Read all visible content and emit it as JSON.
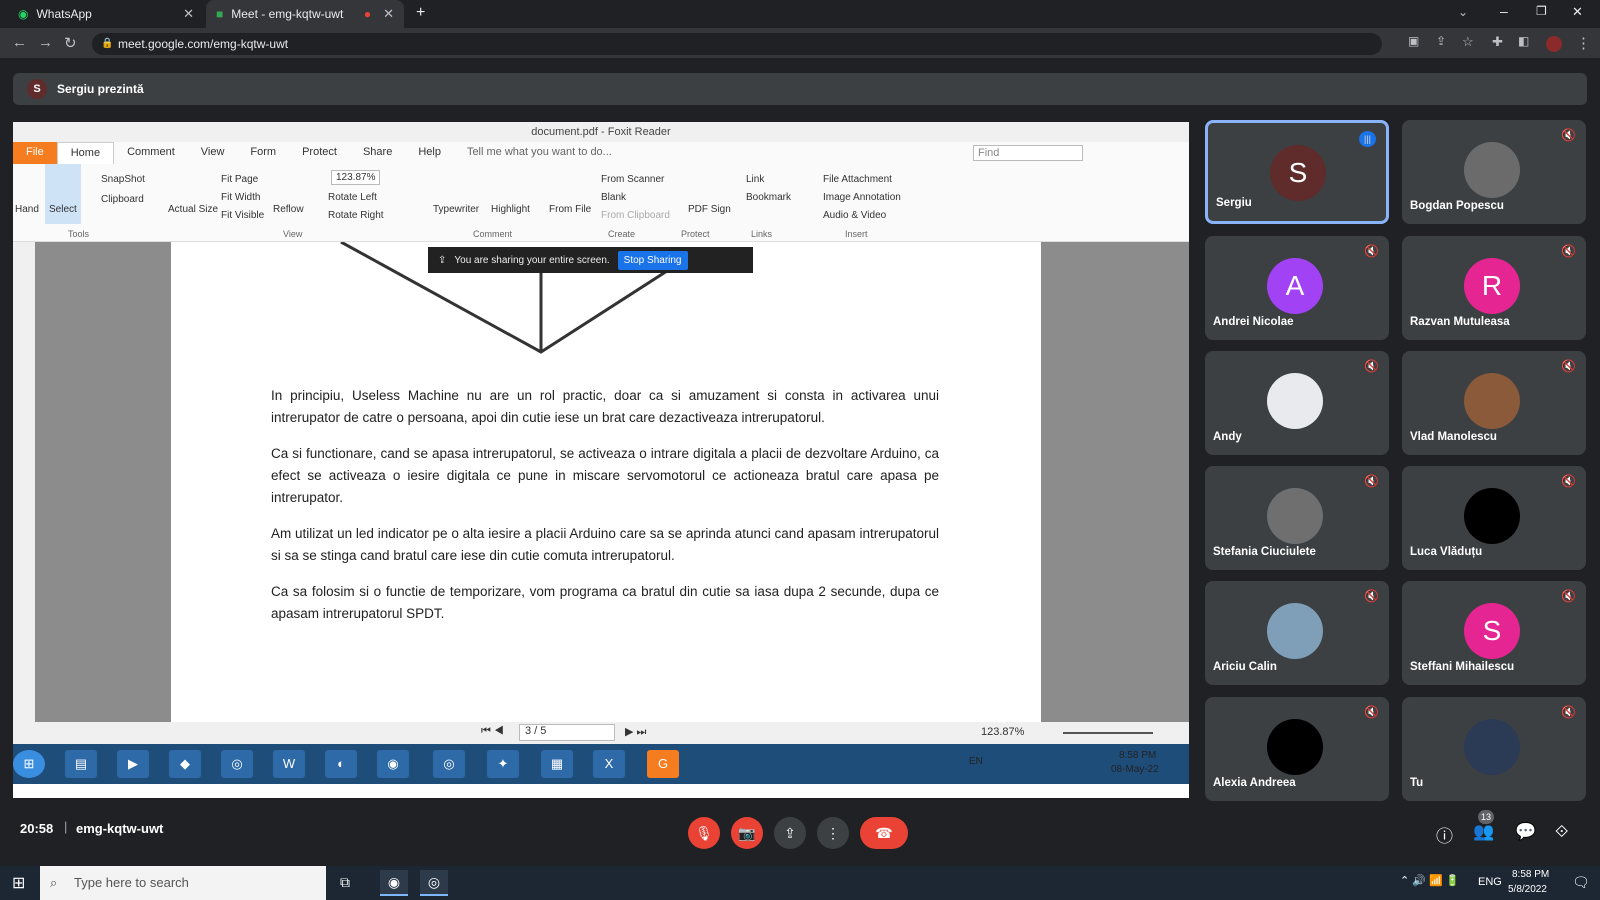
{
  "browser": {
    "tabs": [
      {
        "title": "WhatsApp",
        "icon": "whatsapp-icon"
      },
      {
        "title": "Meet - emg-kqtw-uwt",
        "icon": "meet-icon"
      }
    ],
    "url": "meet.google.com/emg-kqtw-uwt"
  },
  "meet": {
    "presenter_text": "Sergiu prezintă",
    "presenter_initial": "S",
    "time": "20:58",
    "meeting_code": "emg-kqtw-uwt",
    "participants_count": "13",
    "participants": [
      {
        "name": "Sergiu",
        "initial": "S",
        "color": "#5f2b2b",
        "speaking": true
      },
      {
        "name": "Bogdan Popescu",
        "initial": "",
        "color": "#6b6b6b"
      },
      {
        "name": "Andrei Nicolae",
        "initial": "A",
        "color": "#a142f4"
      },
      {
        "name": "Razvan Mutuleasa",
        "initial": "R",
        "color": "#e52592"
      },
      {
        "name": "Andy",
        "initial": "",
        "color": "#e8eaed"
      },
      {
        "name": "Vlad Manolescu",
        "initial": "",
        "color": "#8a5a3a"
      },
      {
        "name": "Stefania Ciuciulete",
        "initial": "",
        "color": "#6f6f6f"
      },
      {
        "name": "Luca Vlăduțu",
        "initial": "",
        "color": "#000000"
      },
      {
        "name": "Ariciu Calin",
        "initial": "",
        "color": "#7f9fb8"
      },
      {
        "name": "Steffani Mihailescu",
        "initial": "S",
        "color": "#e52592"
      },
      {
        "name": "Alexia Andreea",
        "initial": "",
        "color": "#000000"
      },
      {
        "name": "Tu",
        "initial": "",
        "color": "#2b3a55"
      }
    ]
  },
  "foxit": {
    "title": "document.pdf - Foxit Reader",
    "menu": [
      "File",
      "Home",
      "Comment",
      "View",
      "Form",
      "Protect",
      "Share",
      "Help"
    ],
    "tell_me": "Tell me what you want to do...",
    "find_placeholder": "Find",
    "ribbon": {
      "hand": "Hand",
      "select": "Select",
      "snapshot": "SnapShot",
      "clipboard": "Clipboard",
      "actual_size": "Actual Size",
      "fit_page": "Fit Page",
      "fit_width": "Fit Width",
      "fit_visible": "Fit Visible",
      "reflow": "Reflow",
      "zoom": "123.87%",
      "rotate_left": "Rotate Left",
      "rotate_right": "Rotate Right",
      "typewriter": "Typewriter",
      "highlight": "Highlight",
      "from_file": "From File",
      "from_scanner": "From Scanner",
      "blank": "Blank",
      "from_clipboard": "From Clipboard",
      "pdf_sign": "PDF Sign",
      "link": "Link",
      "bookmark": "Bookmark",
      "file_attachment": "File Attachment",
      "image_annotation": "Image Annotation",
      "audio_video": "Audio & Video"
    },
    "groups": [
      "Tools",
      "View",
      "Comment",
      "Create",
      "Protect",
      "Links",
      "Insert"
    ],
    "share_banner": "You are sharing your entire screen.",
    "stop_sharing": "Stop Sharing",
    "paragraphs": [
      "In principiu, Useless Machine nu are un rol practic, doar ca si amuzament si consta in activarea unui intrerupator de catre o persoana, apoi din cutie iese un brat care dezactiveaza intrerupatorul.",
      "Ca si functionare, cand se apasa intrerupatorul, se activeaza o intrare digitala a placii de dezvoltare Arduino, ca efect se activeaza o iesire digitala ce pune in miscare servomotorul ce actioneaza bratul care apasa pe intrerupator.",
      "Am utilizat un led indicator pe o alta iesire a placii Arduino care sa se aprinda atunci cand apasam intrerupatorul si sa se stinga cand bratul care iese din cutie comuta intrerupatorul.",
      "Ca sa folosim si o functie de temporizare, vom programa ca bratul din cutie sa iasa dupa 2 secunde, dupa ce apasam intrerupatorul SPDT."
    ],
    "page_indicator": "3 / 5",
    "status_zoom": "123.87%",
    "win7_lang": "EN",
    "win7_time": "8:58 PM",
    "win7_date": "08-May-22"
  },
  "windows": {
    "search_placeholder": "Type here to search",
    "lang": "ENG",
    "time": "8:58 PM",
    "date": "5/8/2022"
  }
}
